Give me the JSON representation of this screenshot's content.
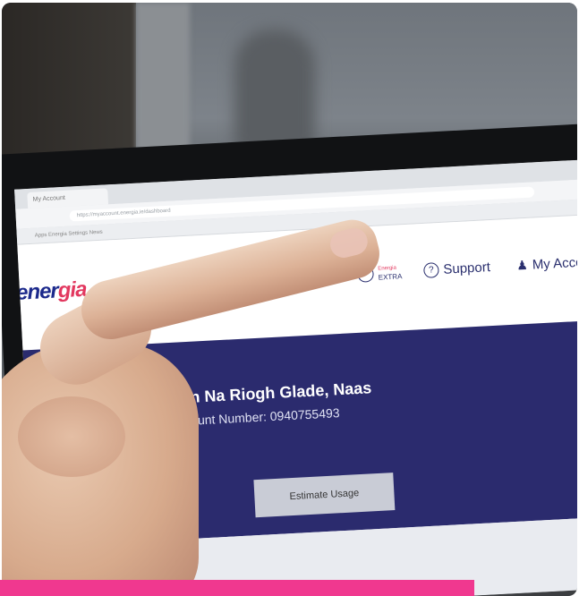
{
  "browser": {
    "tab_label": "My Account",
    "url": "https://myaccount.energia.ie/dashboard",
    "bookmarks": "Apps   Energia   Settings   News"
  },
  "site": {
    "logo_main": "ener",
    "logo_accent": "gia",
    "nav_extra_top": "Energia",
    "nav_extra_bottom": "EXTRA",
    "nav_support": "Support",
    "nav_account": "My Acco"
  },
  "hero": {
    "address": "Dun Na Riogh Glade, Naas",
    "account_number": "Account Number: 0940755493",
    "estimate_button": "Estimate Usage"
  },
  "colors": {
    "hero_bg": "#2b2b6e",
    "brand_pink": "#f0388f",
    "brand_blue": "#1c2a8c"
  }
}
